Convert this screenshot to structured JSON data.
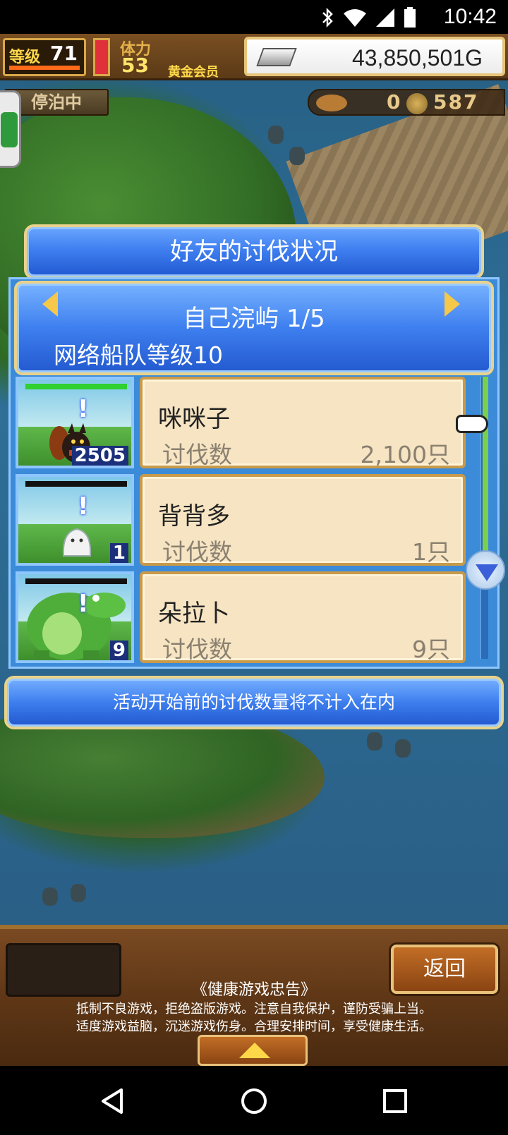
{
  "status_bar": {
    "time": "10:42",
    "icons": [
      "bluetooth-icon",
      "wifi-icon",
      "signal-icon",
      "battery-icon"
    ]
  },
  "hud": {
    "level_label": "等级",
    "level_value": "71",
    "stamina_label": "体力",
    "stamina_value": "53",
    "membership": "黄金会员",
    "gold": "43,850,501G",
    "anchored_status": "停泊中",
    "resource_1": "0",
    "resource_2": "587"
  },
  "dialog": {
    "title": "好友的讨伐状况",
    "island": "自己浣屿 1/5",
    "fleet_level": "网络船队等级10",
    "rows": [
      {
        "name": "咪咪子",
        "kill_label": "讨伐数",
        "kill_value": "2,100只",
        "thumb_count": "2505",
        "hp_color": "#2fd02f"
      },
      {
        "name": "背背多",
        "kill_label": "讨伐数",
        "kill_value": "1只",
        "thumb_count": "1",
        "hp_color": "#111111"
      },
      {
        "name": "朵拉卜",
        "kill_label": "讨伐数",
        "kill_value": "9只",
        "thumb_count": "9",
        "hp_color": "#111111"
      }
    ],
    "notice": "活动开始前的讨伐数量将不计入在内"
  },
  "bottom": {
    "back_label": "返回",
    "health_title": "《健康游戏忠告》",
    "health_line1": "抵制不良游戏，拒绝盗版游戏。注意自我保护，谨防受骗上当。",
    "health_line2": "适度游戏益脑，沉迷游戏伤身。合理安排时间，享受健康生活。"
  },
  "colors": {
    "panel_blue": "#3e7fef",
    "card_bg": "#f6e4c2",
    "gold_border": "#e9d38c"
  }
}
